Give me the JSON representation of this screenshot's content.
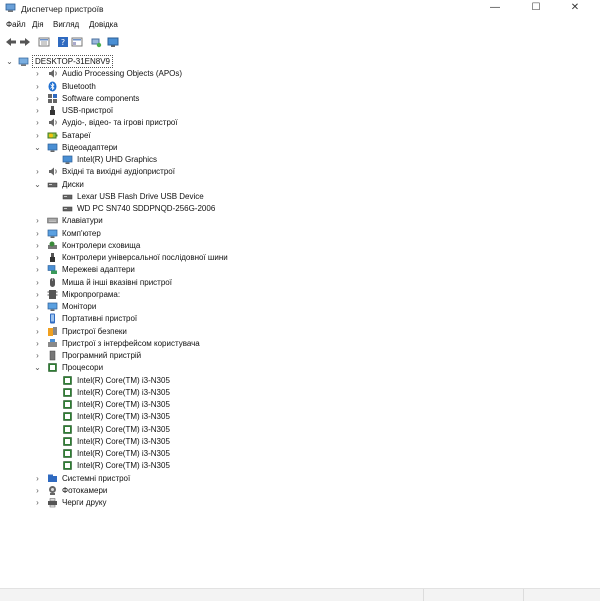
{
  "window": {
    "title": "Диспетчер пристроїв",
    "minimize_glyph": "—",
    "maximize_glyph": "☐",
    "close_glyph": "✕"
  },
  "menu": [
    "Файл",
    "Дія",
    "Вигляд",
    "Довідка"
  ],
  "toolbar": [
    "back-arrow-icon",
    "forward-arrow-icon",
    "properties-icon",
    "help-icon",
    "view-icon",
    "scan-hardware-icon",
    "monitor-icon"
  ],
  "tree": {
    "root": "DESKTOP-31EN8V9",
    "items": [
      {
        "label": "Audio Processing Objects (APOs)",
        "icon": "speaker",
        "expanded": false
      },
      {
        "label": "Bluetooth",
        "icon": "bluetooth",
        "expanded": false
      },
      {
        "label": "Software components",
        "icon": "software",
        "expanded": false
      },
      {
        "label": "USB-пристрої",
        "icon": "usb",
        "expanded": false
      },
      {
        "label": "Аудіо-, відео- та ігрові пристрої",
        "icon": "speaker",
        "expanded": false
      },
      {
        "label": "Батареї",
        "icon": "battery",
        "expanded": false
      },
      {
        "label": "Відеоадаптери",
        "icon": "display",
        "expanded": true,
        "children": [
          "Intel(R) UHD Graphics"
        ],
        "child_icon": "display"
      },
      {
        "label": "Вхідні та вихідні аудіопристрої",
        "icon": "speaker",
        "expanded": false
      },
      {
        "label": "Диски",
        "icon": "disk",
        "expanded": true,
        "children": [
          "Lexar USB Flash Drive USB Device",
          "WD PC SN740 SDDPNQD-256G-2006"
        ],
        "child_icon": "disk"
      },
      {
        "label": "Клавіатури",
        "icon": "keyboard",
        "expanded": false
      },
      {
        "label": "Комп'ютер",
        "icon": "monitor",
        "expanded": false
      },
      {
        "label": "Контролери сховища",
        "icon": "storage",
        "expanded": false
      },
      {
        "label": "Контролери універсальної послідовної шини",
        "icon": "usb",
        "expanded": false
      },
      {
        "label": "Мережеві адаптери",
        "icon": "network",
        "expanded": false
      },
      {
        "label": "Миша й інші вказівні пристрої",
        "icon": "mouse",
        "expanded": false
      },
      {
        "label": "Мікропрограма:",
        "icon": "firmware",
        "expanded": false
      },
      {
        "label": "Монітори",
        "icon": "monitor",
        "expanded": false
      },
      {
        "label": "Портативні пристрої",
        "icon": "portable",
        "expanded": false
      },
      {
        "label": "Пристрої безпеки",
        "icon": "security",
        "expanded": false
      },
      {
        "label": "Пристрої з інтерфейсом користувача",
        "icon": "hid",
        "expanded": false
      },
      {
        "label": "Програмний пристрій",
        "icon": "software-device",
        "expanded": false
      },
      {
        "label": "Процесори",
        "icon": "cpu",
        "expanded": true,
        "children": [
          "Intel(R) Core(TM) i3-N305",
          "Intel(R) Core(TM) i3-N305",
          "Intel(R) Core(TM) i3-N305",
          "Intel(R) Core(TM) i3-N305",
          "Intel(R) Core(TM) i3-N305",
          "Intel(R) Core(TM) i3-N305",
          "Intel(R) Core(TM) i3-N305",
          "Intel(R) Core(TM) i3-N305"
        ],
        "child_icon": "cpu"
      },
      {
        "label": "Системні пристрої",
        "icon": "system",
        "expanded": false
      },
      {
        "label": "Фотокамери",
        "icon": "camera",
        "expanded": false
      },
      {
        "label": "Черги друку",
        "icon": "printer",
        "expanded": false
      }
    ]
  }
}
